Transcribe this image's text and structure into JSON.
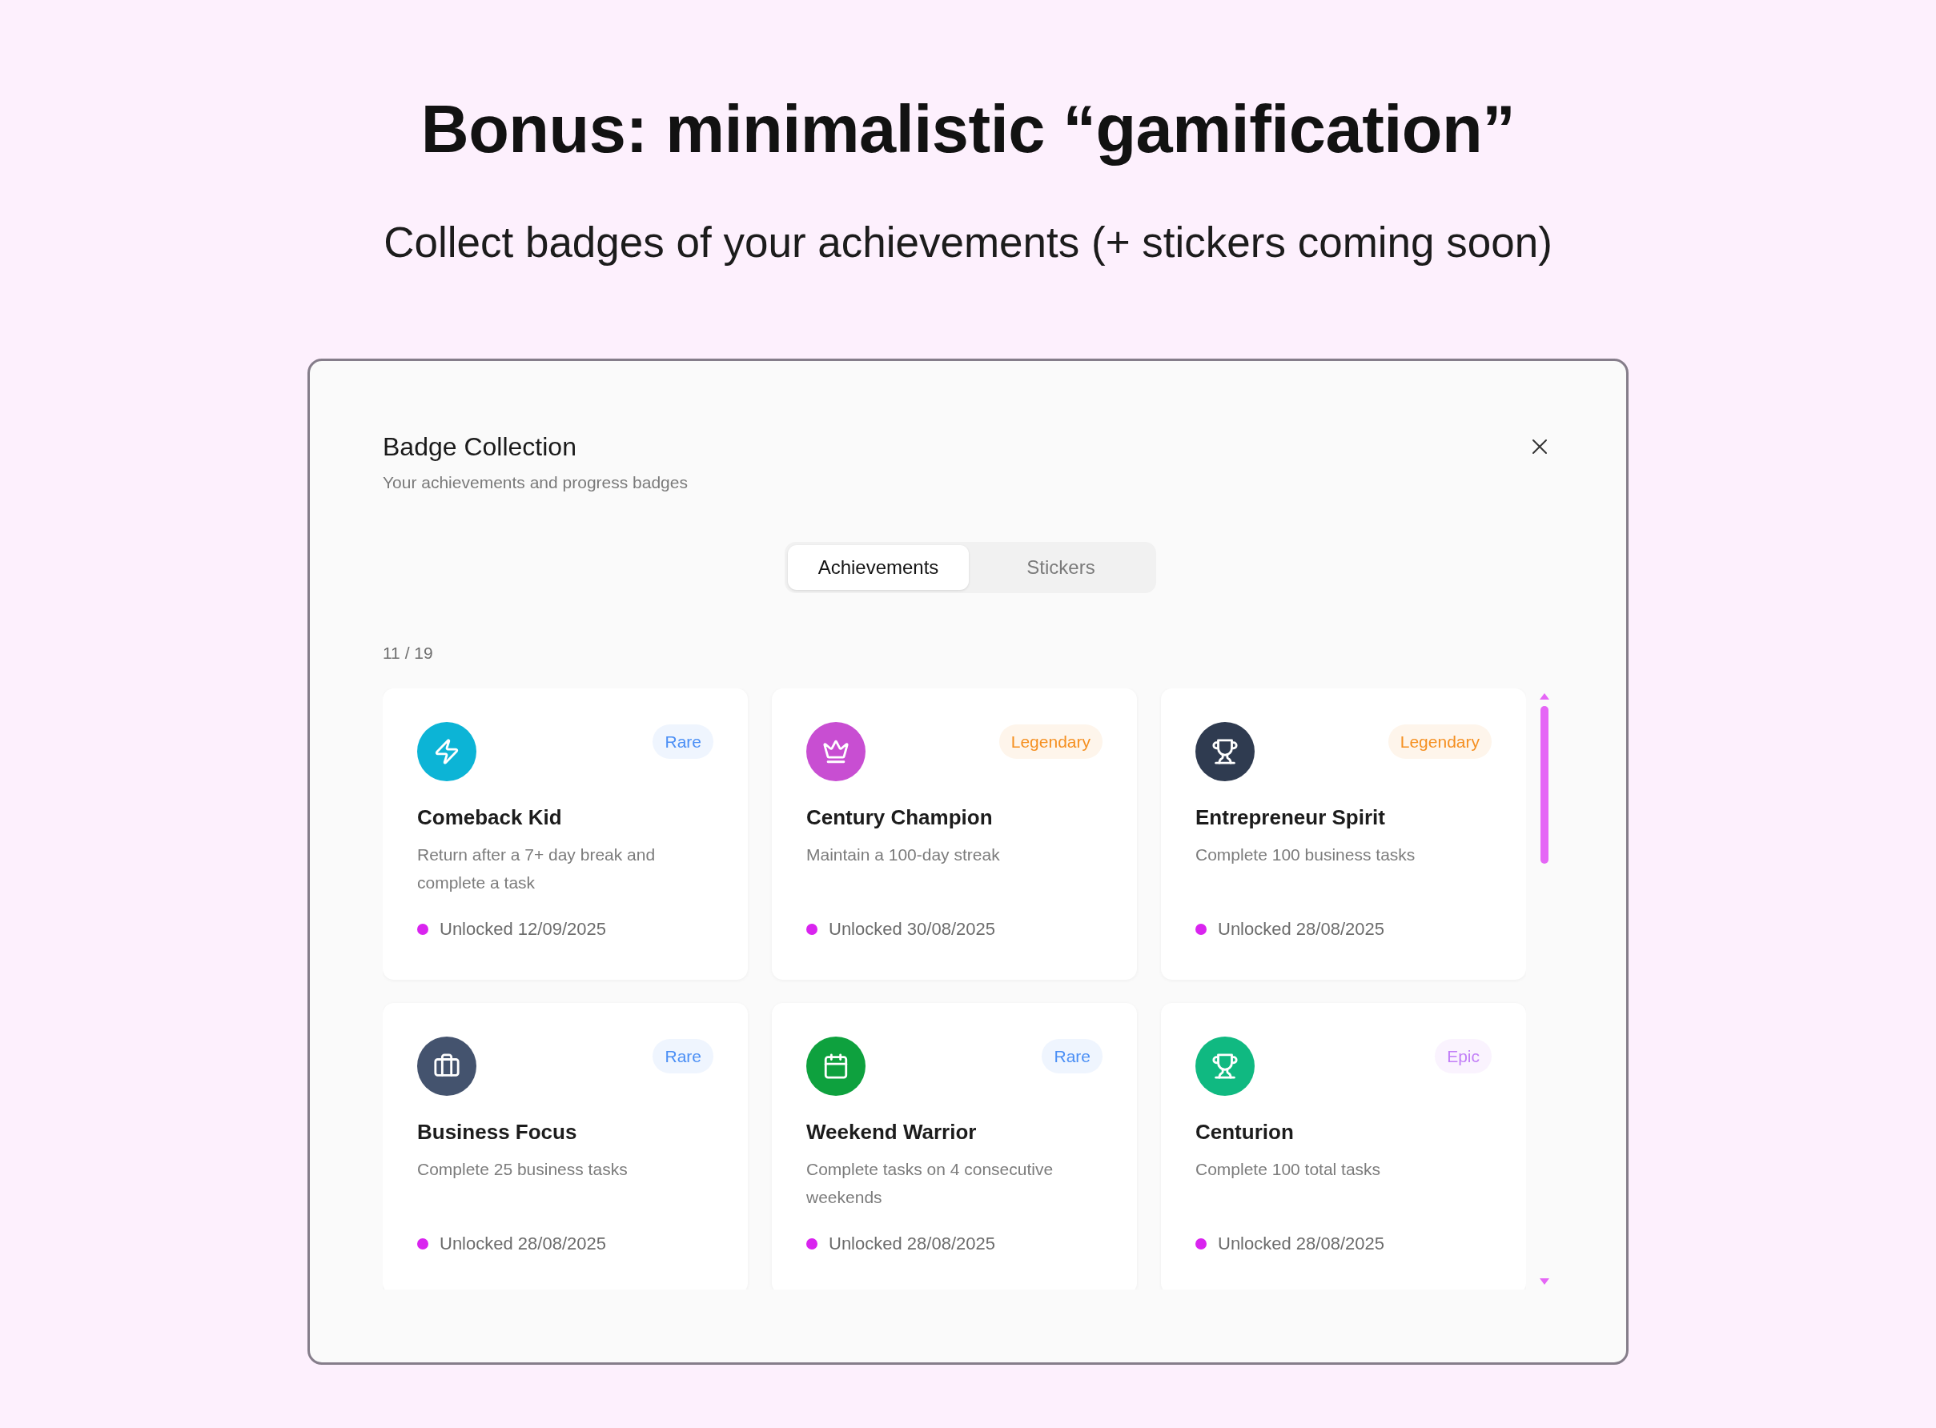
{
  "heading": {
    "title": "Bonus: minimalistic “gamification”",
    "subtitle": "Collect badges of your achievements (+ stickers coming soon)"
  },
  "dialog": {
    "title": "Badge Collection",
    "subtitle": "Your achievements and progress badges",
    "tabs": [
      {
        "label": "Achievements",
        "selected": true
      },
      {
        "label": "Stickers",
        "selected": false
      }
    ],
    "count": "11 / 19",
    "cards": [
      {
        "kind": "lightning",
        "color": "#0cb4d6",
        "rarity": {
          "label": "Rare",
          "color": "#4b8ff5"
        },
        "title": "Comeback Kid",
        "description": "Return after a 7+ day break and complete a task",
        "unlocked": "Unlocked 12/09/2025"
      },
      {
        "kind": "crown",
        "color": "#c84ed2",
        "rarity": {
          "label": "Legendary",
          "color": "#f59022"
        },
        "title": "Century Champion",
        "description": "Maintain a 100-day streak",
        "unlocked": "Unlocked 30/08/2025"
      },
      {
        "kind": "trophy",
        "color": "#2f3b50",
        "rarity": {
          "label": "Legendary",
          "color": "#f59022"
        },
        "title": "Entrepreneur Spirit",
        "description": "Complete 100 business tasks",
        "unlocked": "Unlocked 28/08/2025"
      },
      {
        "kind": "briefcase",
        "color": "#44536e",
        "rarity": {
          "label": "Rare",
          "color": "#4b8ff5"
        },
        "title": "Business Focus",
        "description": "Complete 25 business tasks",
        "unlocked": "Unlocked 28/08/2025"
      },
      {
        "kind": "calendar",
        "color": "#0ea13e",
        "rarity": {
          "label": "Rare",
          "color": "#4b8ff5"
        },
        "title": "Weekend Warrior",
        "description": "Complete tasks on 4 consecutive weekends",
        "unlocked": "Unlocked 28/08/2025"
      },
      {
        "kind": "trophy",
        "color": "#10b981",
        "rarity": {
          "label": "Epic",
          "color": "#c27ff7"
        },
        "title": "Centurion",
        "description": "Complete 100 total tasks",
        "unlocked": "Unlocked 28/08/2025"
      }
    ]
  }
}
